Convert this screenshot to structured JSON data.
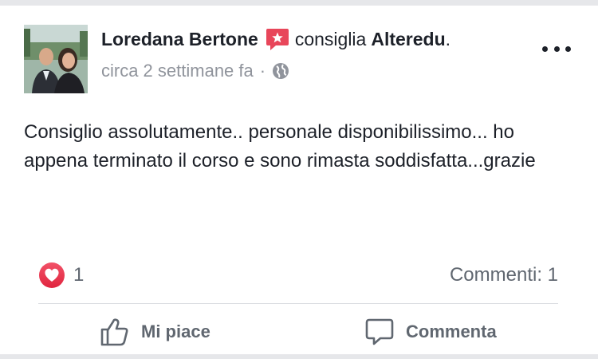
{
  "post": {
    "author": "Loredana Bertone",
    "verb": "consiglia",
    "page": "Alteredu",
    "page_suffix": ".",
    "timestamp": "circa 2 settimane fa",
    "separator": "·",
    "privacy_icon": "globe-icon",
    "text": "Consiglio assolutamente.. personale disponibilissimo... ho appena terminato il corso e sono rimasta soddisfatta...grazie"
  },
  "stats": {
    "reaction_icon": "heart-reaction-icon",
    "reaction_count": "1",
    "comments_label": "Commenti: 1"
  },
  "actions": {
    "like_label": "Mi piace",
    "comment_label": "Commenta"
  },
  "colors": {
    "text_primary": "#1d2129",
    "text_secondary": "#90949c",
    "recommend_badge": "#e8465a",
    "heart_reaction": "#e8314a"
  }
}
